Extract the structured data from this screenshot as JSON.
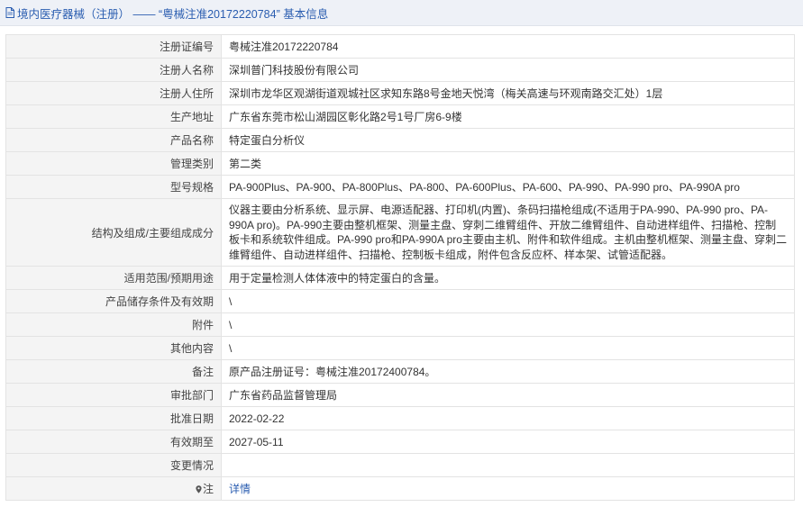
{
  "header": {
    "title": "境内医疗器械（注册） —— “粤械注准20172220784” 基本信息"
  },
  "rows": [
    {
      "label": "注册证编号",
      "value": "粤械注准20172220784"
    },
    {
      "label": "注册人名称",
      "value": "深圳普门科技股份有限公司"
    },
    {
      "label": "注册人住所",
      "value": "深圳市龙华区观湖街道观城社区求知东路8号金地天悦湾（梅关高速与环观南路交汇处）1层"
    },
    {
      "label": "生产地址",
      "value": "广东省东莞市松山湖园区彰化路2号1号厂房6-9楼"
    },
    {
      "label": "产品名称",
      "value": "特定蛋白分析仪"
    },
    {
      "label": "管理类别",
      "value": "第二类"
    },
    {
      "label": "型号规格",
      "value": "PA-900Plus、PA-900、PA-800Plus、PA-800、PA-600Plus、PA-600、PA-990、PA-990 pro、PA-990A pro"
    },
    {
      "label": "结构及组成/主要组成成分",
      "value": "仪器主要由分析系统、显示屏、电源适配器、打印机(内置)、条码扫描枪组成(不适用于PA-990、PA-990 pro、PA-990A pro)。PA-990主要由整机框架、测量主盘、穿刺二维臂组件、开放二维臂组件、自动进样组件、扫描枪、控制板卡和系统软件组成。PA-990 pro和PA-990A pro主要由主机、附件和软件组成。主机由整机框架、测量主盘、穿刺二维臂组件、自动进样组件、扫描枪、控制板卡组成，附件包含反应杯、样本架、试管适配器。"
    },
    {
      "label": "适用范围/预期用途",
      "value": "用于定量检测人体体液中的特定蛋白的含量。"
    },
    {
      "label": "产品储存条件及有效期",
      "value": "\\"
    },
    {
      "label": "附件",
      "value": "\\"
    },
    {
      "label": "其他内容",
      "value": "\\"
    },
    {
      "label": "备注",
      "value": "原产品注册证号：粤械注准20172400784。"
    },
    {
      "label": "审批部门",
      "value": "广东省药品监督管理局"
    },
    {
      "label": "批准日期",
      "value": "2022-02-22"
    },
    {
      "label": "有效期至",
      "value": "2027-05-11"
    },
    {
      "label": "变更情况",
      "value": ""
    }
  ],
  "note": {
    "label": "注",
    "link": "详情",
    "icon": "pin-icon"
  },
  "colors": {
    "header_bg": "#eef1f7",
    "link": "#2a5db0",
    "label_bg": "#f4f4f4",
    "border": "#e3e3e3"
  }
}
